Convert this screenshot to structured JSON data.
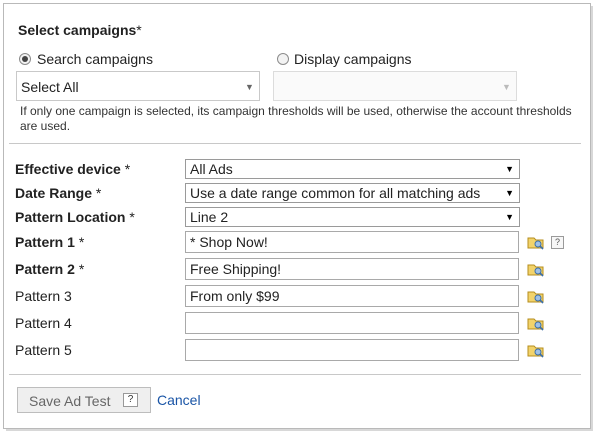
{
  "title": "Select campaigns",
  "required_mark": "*",
  "campaign_types": [
    {
      "label": "Search campaigns",
      "selected": true
    },
    {
      "label": "Display campaigns",
      "selected": false
    }
  ],
  "search_select": {
    "value": "Select All"
  },
  "display_select": {
    "value": ""
  },
  "note": "If only one campaign is selected, its campaign thresholds will be used, otherwise the account thresholds are used.",
  "fields": {
    "effective_device": {
      "label": "Effective device",
      "value": "All Ads"
    },
    "date_range": {
      "label": "Date Range",
      "value": "Use a date range common for all matching ads"
    },
    "pattern_location": {
      "label": "Pattern Location",
      "value": "Line 2"
    }
  },
  "patterns": [
    {
      "label": "Pattern 1",
      "required": true,
      "value": "* Shop Now!"
    },
    {
      "label": "Pattern 2",
      "required": true,
      "value": "Free Shipping!"
    },
    {
      "label": "Pattern 3",
      "required": false,
      "value": "From only $99"
    },
    {
      "label": "Pattern 4",
      "required": false,
      "value": ""
    },
    {
      "label": "Pattern 5",
      "required": false,
      "value": ""
    }
  ],
  "help_glyph": "?",
  "save_button": "Save Ad Test",
  "cancel_link": "Cancel",
  "icons": {
    "magic": "magic-wand-icon",
    "help": "help-icon",
    "arrow": "dropdown-arrow-icon"
  }
}
